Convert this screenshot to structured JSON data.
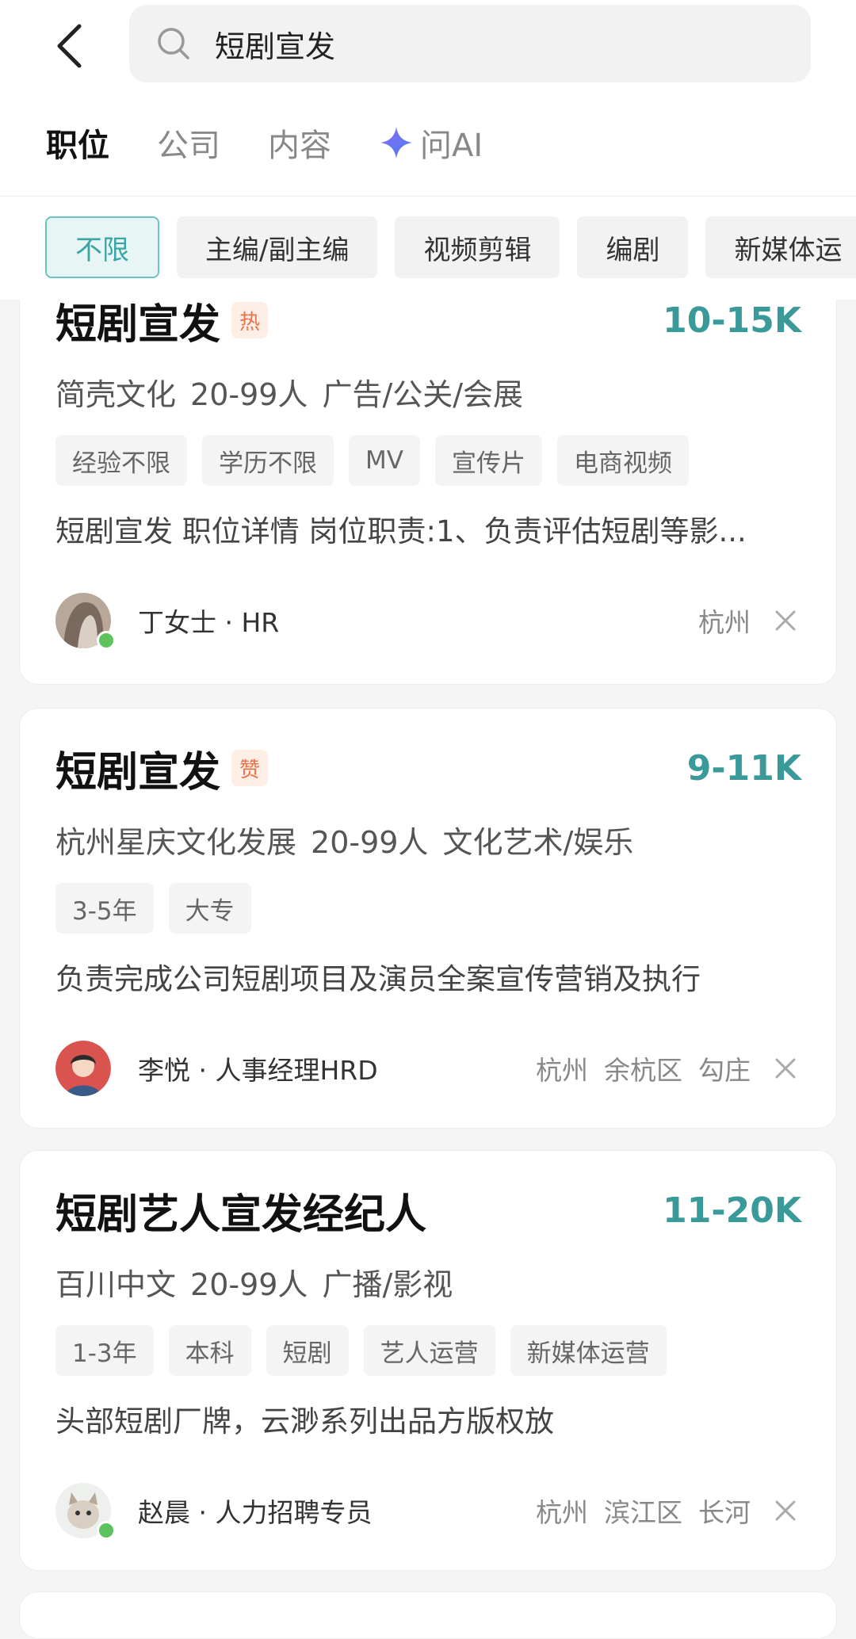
{
  "search": {
    "query": "短剧宣发"
  },
  "tabs": [
    {
      "label": "职位"
    },
    {
      "label": "公司"
    },
    {
      "label": "内容"
    },
    {
      "label": "问AI"
    }
  ],
  "filters": [
    "不限",
    "主编/副主编",
    "视频剪辑",
    "编剧",
    "新媒体运"
  ],
  "colors": {
    "accent": "#3a9a9a",
    "chip_selected_bg": "#e8f5f5",
    "badge_bg": "#fdeee6",
    "online": "#5cc35c"
  },
  "jobs": [
    {
      "title": "短剧宣发",
      "badge": "热",
      "salary": "10-15K",
      "company": [
        "简壳文化",
        "20-99人",
        "广告/公关/会展"
      ],
      "tags": [
        "经验不限",
        "学历不限",
        "MV",
        "宣传片",
        "电商视频"
      ],
      "desc": "短剧宣发 职位详情 岗位职责:1、负责评估短剧等影...",
      "hr": "丁女士 · HR",
      "location": [
        "杭州"
      ],
      "online": true
    },
    {
      "title": "短剧宣发",
      "badge": "赞",
      "salary": "9-11K",
      "company": [
        "杭州星庆文化发展",
        "20-99人",
        "文化艺术/娱乐"
      ],
      "tags": [
        "3-5年",
        "大专"
      ],
      "desc": "负责完成公司短剧项目及演员全案宣传营销及执行",
      "hr": "李悦 · 人事经理HRD",
      "location": [
        "杭州",
        "余杭区",
        "勾庄"
      ],
      "online": false
    },
    {
      "title": "短剧艺人宣发经纪人",
      "badge": "",
      "salary": "11-20K",
      "company": [
        "百川中文",
        "20-99人",
        "广播/影视"
      ],
      "tags": [
        "1-3年",
        "本科",
        "短剧",
        "艺人运营",
        "新媒体运营"
      ],
      "desc": "头部短剧厂牌，云渺系列出品方版权放",
      "hr": "赵晨 · 人力招聘专员",
      "location": [
        "杭州",
        "滨江区",
        "长河"
      ],
      "online": true
    }
  ]
}
